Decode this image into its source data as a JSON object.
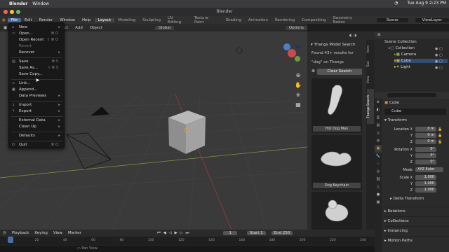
{
  "mac": {
    "app": "Blender",
    "menu_window": "Window",
    "datetime": "Tue Aug 9  2:23 PM"
  },
  "window_title": "Blender",
  "topbar": {
    "menus": [
      "File",
      "Edit",
      "Render",
      "Window",
      "Help"
    ],
    "workspaces": [
      "Layout",
      "Modeling",
      "Sculpting",
      "UV Editing",
      "Texture Paint",
      "Shading",
      "Animation",
      "Rendering",
      "Compositing",
      "Geometry Nodes"
    ],
    "scene": "Scene",
    "view_layer": "ViewLayer"
  },
  "viewport_header": {
    "items": [
      "Select",
      "Add",
      "Object"
    ],
    "orientation": "Global",
    "options": "Options"
  },
  "file_menu": {
    "items": [
      {
        "label": "New",
        "shortcut": "",
        "arrow": true
      },
      {
        "label": "Open...",
        "shortcut": "⌘ O"
      },
      {
        "label": "Open Recent",
        "shortcut": "⇧ ⌘ O",
        "arrow": true
      },
      {
        "label": "Revert",
        "shortcut": "",
        "dim": true
      },
      {
        "label": "Recover",
        "shortcut": "",
        "arrow": true
      },
      {
        "label": "Save",
        "shortcut": "⌘ S"
      },
      {
        "label": "Save As...",
        "shortcut": "⇧ ⌘ S"
      },
      {
        "label": "Save Copy...",
        "shortcut": ""
      },
      {
        "label": "Link...",
        "shortcut": ""
      },
      {
        "label": "Append...",
        "shortcut": ""
      },
      {
        "label": "Data Previews",
        "shortcut": "",
        "arrow": true
      },
      {
        "label": "Import",
        "shortcut": "",
        "arrow": true
      },
      {
        "label": "Export",
        "shortcut": "",
        "arrow": true
      },
      {
        "label": "External Data",
        "shortcut": "",
        "arrow": true
      },
      {
        "label": "Clean Up",
        "shortcut": "",
        "arrow": true
      },
      {
        "label": "Defaults",
        "shortcut": "",
        "arrow": true
      },
      {
        "label": "Quit",
        "shortcut": "⌘ Q"
      }
    ]
  },
  "thangs": {
    "title": "Thangs Model Search",
    "results_line1": "Found 43+ results for",
    "results_line2": "\"dog\" on Thangs",
    "clear_button": "Clear Search",
    "results": [
      "Hot Dog Man",
      "Dog Keychain"
    ]
  },
  "side_tabs": [
    "Item",
    "Tool",
    "View",
    "Thangs Search"
  ],
  "outliner": {
    "root": "Scene Collection",
    "items": [
      "Collection",
      "Camera",
      "Cube",
      "Light"
    ]
  },
  "properties": {
    "search_placeholder": "",
    "object_name": "Cube",
    "object_field": "Cube",
    "transform_label": "Transform",
    "location_label": "Location X",
    "location": [
      "0 m",
      "0 m",
      "0 m"
    ],
    "rotation_label": "Rotation X",
    "rotation": [
      "0°",
      "0°",
      "0°"
    ],
    "mode_label": "Mode",
    "mode": "XYZ Euler",
    "scale_label": "Scale X",
    "scale": [
      "1.000",
      "1.000",
      "1.000"
    ],
    "axis_y": "Y",
    "axis_z": "Z",
    "sections": [
      "Delta Transform",
      "Relations",
      "Collections",
      "Instancing",
      "Motion Paths"
    ]
  },
  "timeline": {
    "menus": [
      "Playback",
      "Keying",
      "View",
      "Marker"
    ],
    "current_frame": "1",
    "start_label": "Start",
    "start": "1",
    "end_label": "End",
    "end": "250",
    "ticks": [
      "0",
      "20",
      "40",
      "60",
      "80",
      "100",
      "120",
      "140",
      "160",
      "180",
      "200",
      "220",
      "240"
    ],
    "status": "Pan View"
  }
}
